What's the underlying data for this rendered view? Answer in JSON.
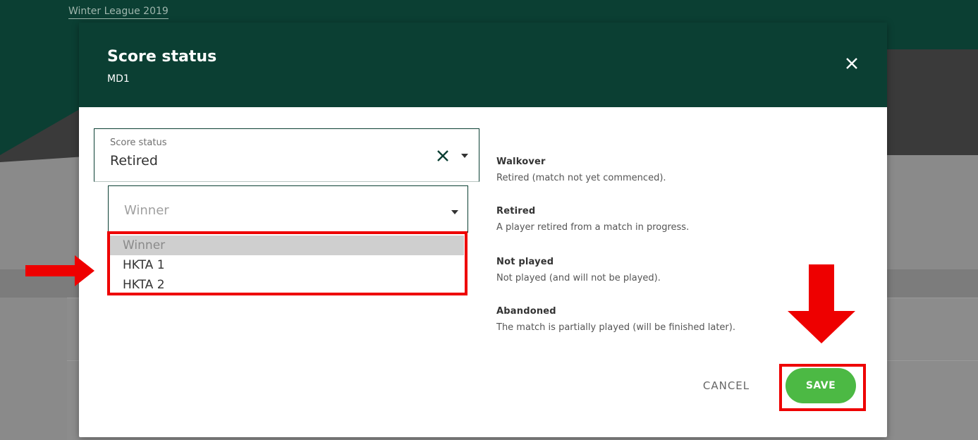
{
  "background": {
    "league_title": "Winter League 2019"
  },
  "modal": {
    "title": "Score status",
    "subtitle": "MD1",
    "close_icon": "close-icon"
  },
  "score_status": {
    "label": "Score status",
    "value": "Retired",
    "clear_icon": "clear-icon",
    "caret_icon": "caret-down-icon"
  },
  "winner_select": {
    "placeholder": "Winner",
    "options": [
      "Winner",
      "HKTA 1",
      "HKTA 2"
    ],
    "highlighted": "Winner"
  },
  "descriptions": [
    {
      "name": "Walkover",
      "text": "Retired (match not yet commenced)."
    },
    {
      "name": "Retired",
      "text": "A player retired from a match in progress."
    },
    {
      "name": "Not played",
      "text": "Not played (and will not be played)."
    },
    {
      "name": "Abandoned",
      "text": "The match is partially played (will be finished later)."
    }
  ],
  "actions": {
    "cancel_label": "CANCEL",
    "save_label": "SAVE"
  },
  "annotation_colors": {
    "highlight": "#ee0000",
    "header": "#0b3f33",
    "save": "#4cb944"
  }
}
